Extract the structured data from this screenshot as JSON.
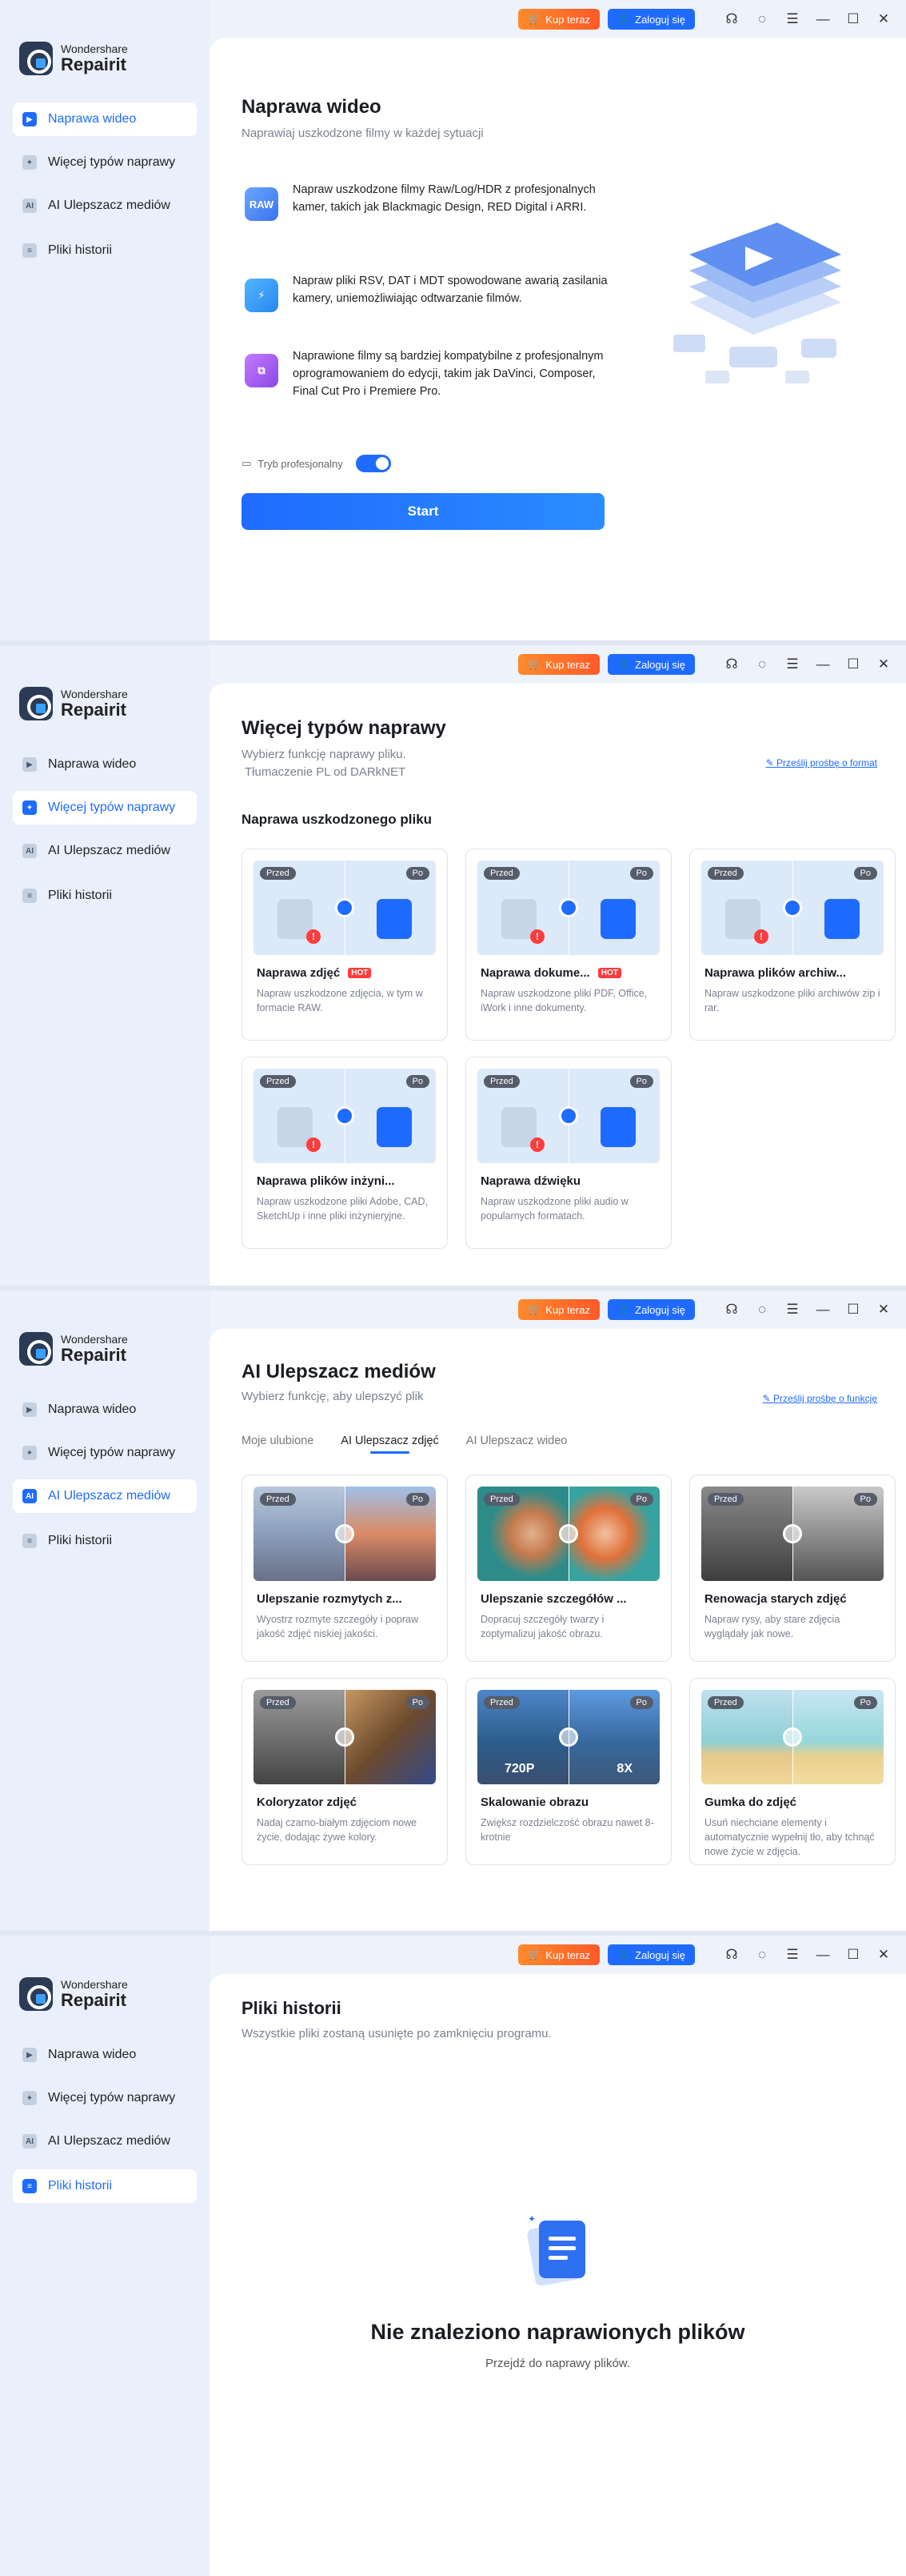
{
  "app": {
    "brand": "Wondershare",
    "name": "Repairit",
    "buy_label": "Kup teraz",
    "login_label": "Zaloguj się"
  },
  "nav": {
    "video": "Naprawa wideo",
    "more": "Więcej typów naprawy",
    "ai": "AI Ulepszacz mediów",
    "history": "Pliki historii"
  },
  "video_repair": {
    "title": "Naprawa wideo",
    "subtitle": "Naprawiaj uszkodzone filmy w każdej sytuacji",
    "features": [
      {
        "icon": "RAW",
        "text": "Napraw uszkodzone filmy Raw/Log/HDR z profesjonalnych kamer, takich jak Blackmagic Design, RED Digital i ARRI."
      },
      {
        "icon": "",
        "text": "Napraw pliki RSV, DAT i MDT spowodowane awarią zasilania kamery, uniemożliwiając odtwarzanie filmów."
      },
      {
        "icon": "",
        "text": "Naprawione filmy są bardziej kompatybilne z profesjonalnym oprogramowaniem do edycji, takim jak DaVinci, Composer, Final Cut Pro i Premiere Pro."
      }
    ],
    "pro_mode_label": "Tryb profesjonalny",
    "pro_mode_on": true,
    "start_label": "Start"
  },
  "more_types": {
    "title": "Więcej typów naprawy",
    "subtitle": "Wybierz funkcję naprawy pliku.",
    "subtitle2": "Tłumaczenie PL od DARkNET",
    "link": "Prześlij prośbę o format",
    "section": "Naprawa uszkodzonego pliku",
    "before": "Przed",
    "after": "Po",
    "cards": [
      {
        "title": "Naprawa zdjęć",
        "hot": "HOT",
        "desc": "Napraw uszkodzone zdjęcia, w tym w formacie RAW."
      },
      {
        "title": "Naprawa dokume...",
        "hot": "HOT",
        "desc": "Napraw uszkodzone pliki PDF, Office, iWork i inne dokumenty."
      },
      {
        "title": "Naprawa plików archiw...",
        "hot": "",
        "desc": "Napraw uszkodzone pliki archiwów zip i rar."
      },
      {
        "title": "Naprawa plików inżyni...",
        "hot": "",
        "desc": "Napraw uszkodzone pliki Adobe, CAD, SketchUp i inne pliki inżynieryjne."
      },
      {
        "title": "Naprawa dźwięku",
        "hot": "",
        "desc": "Napraw uszkodzone pliki audio w popularnych formatach."
      }
    ]
  },
  "ai_enhancer": {
    "title": "AI Ulepszacz mediów",
    "subtitle": "Wybierz funkcję, aby ulepszyć plik",
    "link": "Prześlij prośbę o funkcję",
    "tabs": [
      "Moje ulubione",
      "AI Ulepszacz zdjęć",
      "AI Ulepszacz wideo"
    ],
    "active_tab": "AI Ulepszacz zdjęć",
    "cards": [
      {
        "title": "Ulepszanie rozmytych z...",
        "desc": "Wyostrz rozmyte szczegóły i popraw jakość zdjęć niskiej jakości."
      },
      {
        "title": "Ulepszanie szczegółów ...",
        "desc": "Dopracuj szczegóły twarzy i zoptymalizuj jakość obrazu."
      },
      {
        "title": "Renowacja starych zdjęć",
        "desc": "Napraw rysy, aby stare zdjęcia wyglądały jak nowe."
      },
      {
        "title": "Koloryzator zdjęć",
        "desc": "Nadaj czarno-białym zdjęciom nowe życie, dodając żywe kolory."
      },
      {
        "title": "Skalowanie obrazu",
        "desc": "Zwiększ rozdzielczość obrazu nawet 8-krotnie",
        "left_label": "720P",
        "right_label": "8X"
      },
      {
        "title": "Gumka do zdjęć",
        "desc": "Usuń niechciane elementy i automatycznie wypełnij tło, aby tchnąć nowe życie w zdjęcia."
      }
    ]
  },
  "history": {
    "title": "Pliki historii",
    "subtitle": "Wszystkie pliki zostaną usunięte po zamknięciu programu.",
    "empty_title": "Nie znaleziono naprawionych plików",
    "empty_sub": "Przejdź do naprawy plików."
  }
}
